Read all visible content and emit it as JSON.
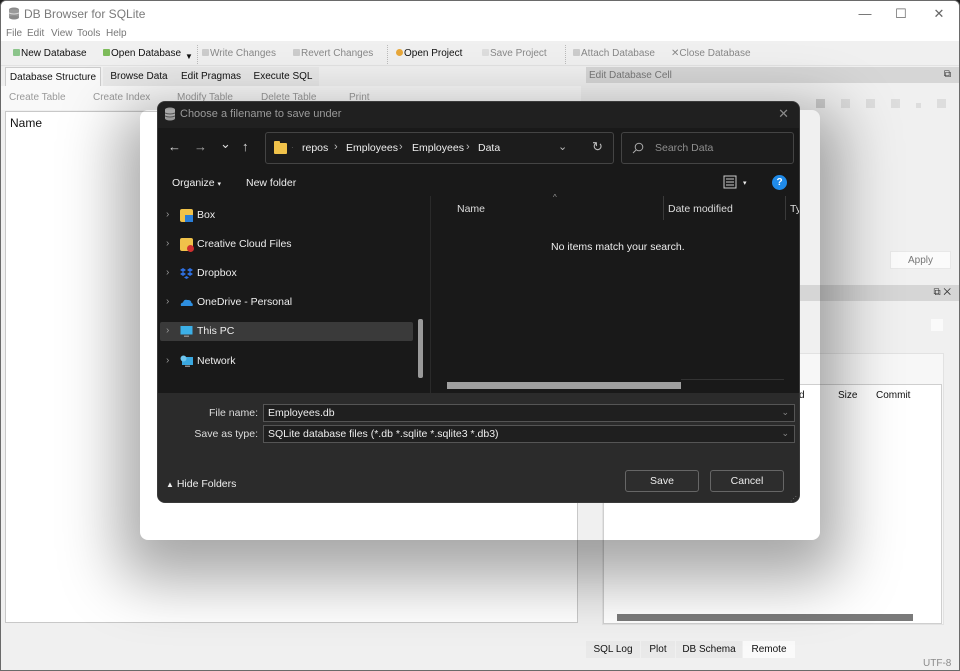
{
  "app": {
    "title": "DB Browser for SQLite",
    "window_controls": {
      "minimize": "—",
      "maximize": "☐",
      "close": "✕"
    }
  },
  "menu": [
    "File",
    "Edit",
    "View",
    "Tools",
    "Help"
  ],
  "toolbar": {
    "new_database": "New Database",
    "open_database": "Open Database",
    "write_changes": "Write Changes",
    "revert_changes": "Revert Changes",
    "open_project": "Open Project",
    "save_project": "Save Project",
    "attach_database": "Attach Database",
    "close_database": "Close Database"
  },
  "tabs": [
    "Database Structure",
    "Browse Data",
    "Edit Pragmas",
    "Execute SQL"
  ],
  "structure_toolbar": {
    "create_table": "Create Table",
    "create_index": "Create Index",
    "modify_table": "Modify Table",
    "delete_table": "Delete Table",
    "print": "Print"
  },
  "tree": {
    "header": "Name"
  },
  "edit_cell_dock": {
    "title": "Edit Database Cell",
    "apply": "Apply"
  },
  "remote_dock": {
    "columns": [
      "d",
      "Size",
      "Commit"
    ]
  },
  "bottom_tabs": [
    "SQL Log",
    "Plot",
    "DB Schema",
    "Remote"
  ],
  "status": {
    "encoding": "UTF-8"
  },
  "dialog": {
    "title": "Choose a filename to save under",
    "nav": {
      "back": "←",
      "forward": "→",
      "recent": "⌄",
      "up": "↑"
    },
    "breadcrumb": [
      "repos",
      "Employees",
      "Employees",
      "Data"
    ],
    "search_placeholder": "Search Data",
    "organize": "Organize",
    "new_folder": "New folder",
    "help": "?",
    "nav_pane": [
      {
        "label": "Box",
        "icon": "box-folder-icon",
        "color": "#2a7ed8"
      },
      {
        "label": "Creative Cloud Files",
        "icon": "creative-cloud-folder-icon",
        "color": "#d03030"
      },
      {
        "label": "Dropbox",
        "icon": "dropbox-icon",
        "color": "#2e6fe0"
      },
      {
        "label": "OneDrive - Personal",
        "icon": "onedrive-icon",
        "color": "#2e8fe0"
      },
      {
        "label": "This PC",
        "icon": "computer-icon",
        "color": "#3cb0e8",
        "selected": true
      },
      {
        "label": "Network",
        "icon": "network-icon",
        "color": "#3aa8e0"
      }
    ],
    "columns": [
      "Name",
      "Date modified",
      "Ty"
    ],
    "empty_message": "No items match your search.",
    "file_name_label": "File name:",
    "file_name_value": "Employees.db",
    "save_type_label": "Save as type:",
    "save_type_value": "SQLite database files (*.db *.sqlite *.sqlite3 *.db3)",
    "hide_folders": "Hide Folders",
    "save": "Save",
    "cancel": "Cancel"
  }
}
